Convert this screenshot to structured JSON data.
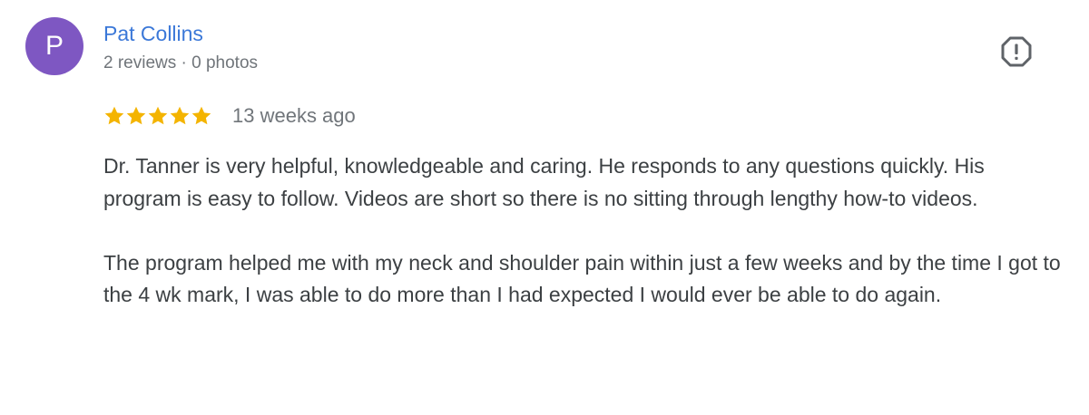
{
  "reviewer": {
    "initial": "P",
    "name": "Pat Collins",
    "meta": "2 reviews · 0 photos",
    "avatar_color": "#7e57c2",
    "name_color": "#3b78d8"
  },
  "review": {
    "rating": 5,
    "max_rating": 5,
    "star_color": "#f4b400",
    "time": "13 weeks ago",
    "paragraphs": [
      "Dr. Tanner is very helpful, knowledgeable and caring. He responds to any questions quickly. His program is easy to follow. Videos are short so there is no sitting through lengthy how-to videos.",
      "The program helped me with my neck and shoulder pain within just a few weeks and by the time I got to the 4 wk mark, I was able to do more than I had expected I would ever be able to do again."
    ]
  },
  "actions": {
    "report_icon": "report-octagon-icon",
    "icon_color": "#5f6368"
  }
}
